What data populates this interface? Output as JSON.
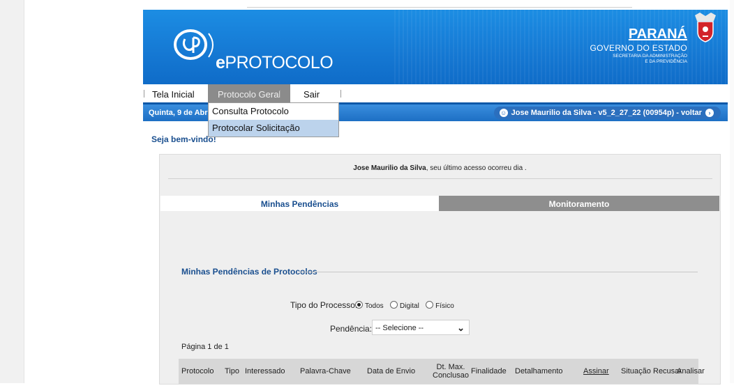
{
  "header": {
    "brand_prefix": "e",
    "brand_name": "PROTOCOLO",
    "state": "PARANÁ",
    "government": "GOVERNO DO ESTADO",
    "secretariat_line1": "SECRETARIA DA ADMINISTRAÇÃO",
    "secretariat_line2": "E DA PREVIDÊNCIA"
  },
  "menu": {
    "items": [
      {
        "label": "Tela Inicial"
      },
      {
        "label": "Protocolo Geral"
      },
      {
        "label": "Sair"
      }
    ],
    "dropdown": [
      {
        "label": "Consulta Protocolo"
      },
      {
        "label": "Protocolar Solicitação"
      }
    ]
  },
  "status": {
    "date": "Quinta, 9 de Abril",
    "user": "Jose Maurilio da Silva - v5_2_27_22 (00954p) - voltar"
  },
  "welcome": "Seja bem-vindo!",
  "panel": {
    "user_name": "Jose Maurilio da Silva",
    "last_access_text": ", seu último acesso ocorreu dia .",
    "tabs": [
      {
        "label": "Minhas Pendências"
      },
      {
        "label": "Monitoramento"
      }
    ],
    "section_title": "Minhas Pendências de Protocolos",
    "process_type_label": "Tipo do Processo:",
    "process_type_options": [
      "Todos",
      "Digital",
      "Físico"
    ],
    "process_type_selected": "Todos",
    "pendencia_label": "Pendência:",
    "pendencia_value": "-- Selecione --",
    "pager": "Página 1 de 1",
    "columns": [
      "Protocolo",
      "Tipo",
      "Interessado",
      "Palavra-Chave",
      "Data de Envio",
      "Dt. Max. Conclusao",
      "Finalidade",
      "Detalhamento",
      "Assinar",
      "Situação",
      "Recusar",
      "Analisar"
    ]
  },
  "colors": {
    "banner_blue": "#1578d3",
    "status_blue": "#1d6fc4",
    "tab_inactive": "#8e8e8e",
    "link_blue": "#1a4f8f"
  }
}
